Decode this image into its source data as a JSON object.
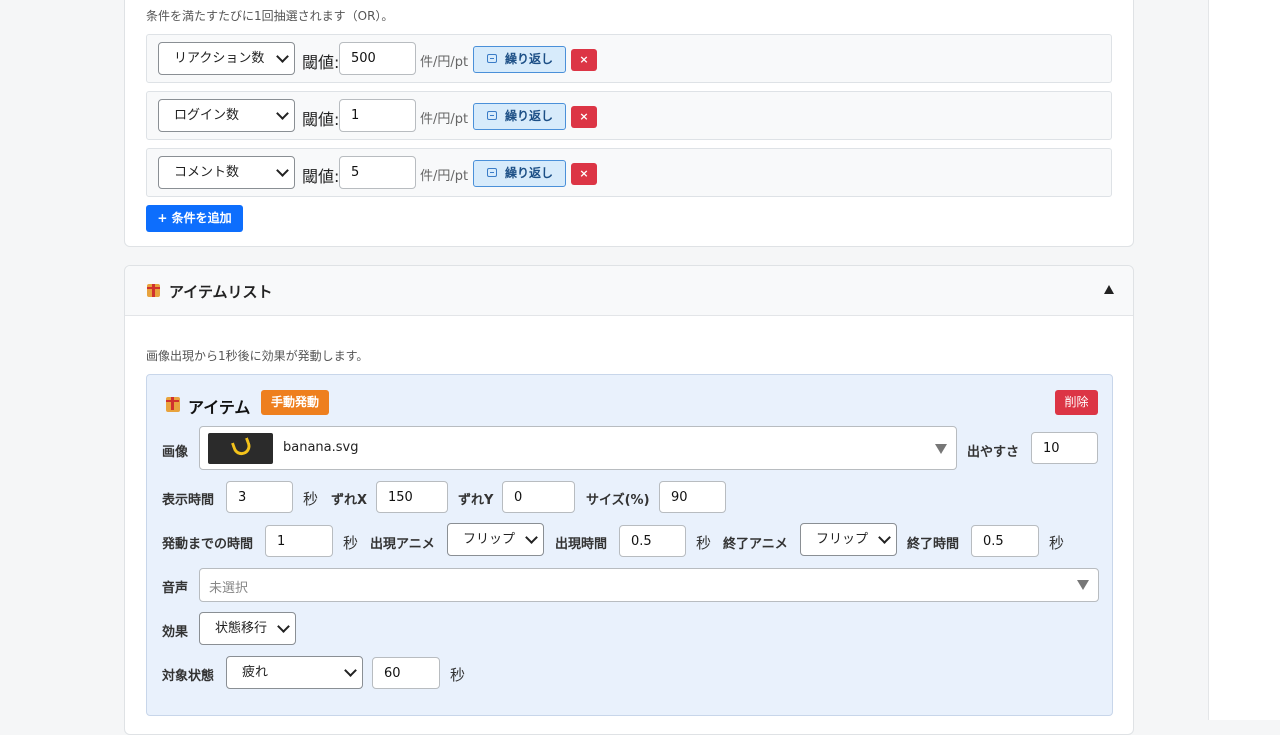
{
  "conditions": {
    "hint": "条件を満たすたびに1回抽選されます（OR）。",
    "threshold_label": "閾値:",
    "unit_label": "件/円/pt",
    "repeat_label": "繰り返し",
    "remove_label": "×",
    "rows": [
      {
        "type": "リアクション数",
        "value": "500"
      },
      {
        "type": "ログイン数",
        "value": "1"
      },
      {
        "type": "コメント数",
        "value": "5"
      }
    ],
    "add_label": "+ 条件を追加"
  },
  "item_list": {
    "title": "アイテムリスト",
    "hint": "画像出現から1秒後に効果が発動します。",
    "item": {
      "title": "アイテム",
      "badge": "手動発動",
      "delete_label": "削除",
      "image_label": "画像",
      "image_file": "banana.svg",
      "chance_label": "出やすさ",
      "chance_value": "10",
      "display_time_label": "表示時間",
      "display_time_value": "3",
      "sec": "秒",
      "offset_x_label": "ずれX",
      "offset_x_value": "150",
      "offset_y_label": "ずれY",
      "offset_y_value": "0",
      "size_label": "サイズ(%)",
      "size_value": "90",
      "delay_label": "発動までの時間",
      "delay_value": "1",
      "appear_anim_label": "出現アニメ",
      "appear_anim_value": "フリップ",
      "appear_time_label": "出現時間",
      "appear_time_value": "0.5",
      "end_anim_label": "終了アニメ",
      "end_anim_value": "フリップ",
      "end_time_label": "終了時間",
      "end_time_value": "0.5",
      "sound_label": "音声",
      "sound_placeholder": "未選択",
      "effect_label": "効果",
      "effect_value": "状態移行",
      "target_state_label": "対象状態",
      "target_state_value": "疲れ",
      "target_state_secs": "60"
    }
  },
  "colors": {
    "primary": "#0d6efd",
    "danger": "#dc3545",
    "warning": "#ee7f1e",
    "item_bg": "#e9f1fc"
  }
}
